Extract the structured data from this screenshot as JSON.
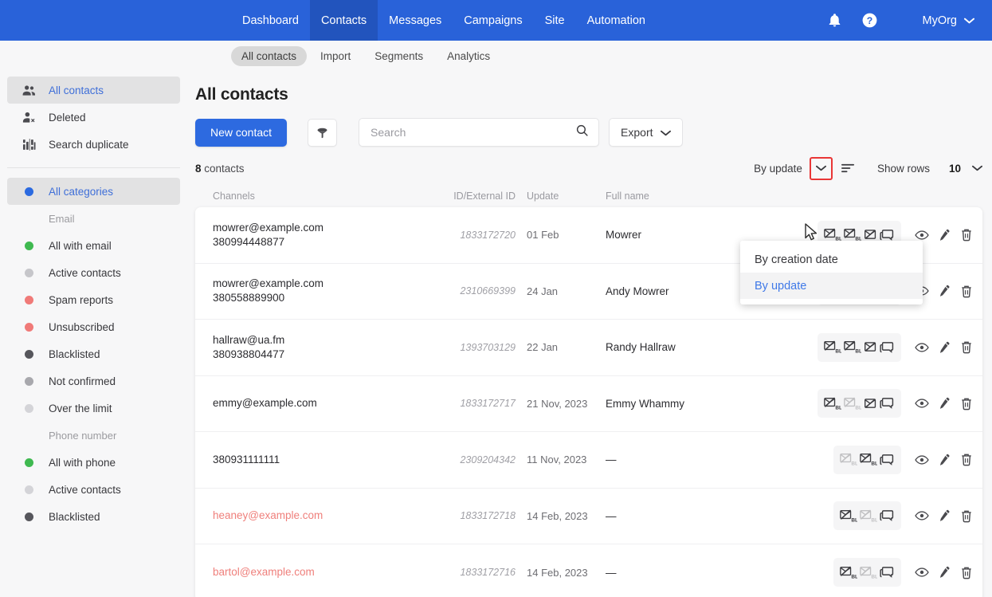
{
  "topnav": {
    "items": [
      {
        "label": "Dashboard",
        "active": false
      },
      {
        "label": "Contacts",
        "active": true
      },
      {
        "label": "Messages",
        "active": false
      },
      {
        "label": "Campaigns",
        "active": false
      },
      {
        "label": "Site",
        "active": false
      },
      {
        "label": "Automation",
        "active": false
      }
    ],
    "bell_icon": "bell-icon",
    "help_icon": "help-circle-icon",
    "org_label": "MyOrg",
    "bg_color": "#2962d9",
    "active_bg_color": "#2254bd"
  },
  "subnav": {
    "items": [
      {
        "label": "All contacts",
        "active": true
      },
      {
        "label": "Import",
        "active": false
      },
      {
        "label": "Segments",
        "active": false
      },
      {
        "label": "Analytics",
        "active": false
      }
    ]
  },
  "sidebar": {
    "top_items": [
      {
        "label": "All contacts",
        "icon": "people-group-icon",
        "active": true
      },
      {
        "label": "Deleted",
        "icon": "person-remove-icon",
        "active": false
      },
      {
        "label": "Search duplicate",
        "icon": "compare-bars-icon",
        "active": false
      }
    ],
    "all_categories": {
      "label": "All categories",
      "dot_color": "#2b6ae0",
      "active": true
    },
    "groups": [
      {
        "label": "Email",
        "items": [
          {
            "label": "All with email",
            "dot_color": "#3fb950"
          },
          {
            "label": "Active contacts",
            "dot_color": "#c6c6ca"
          },
          {
            "label": "Spam reports",
            "dot_color": "#f07a78"
          },
          {
            "label": "Unsubscribed",
            "dot_color": "#f07a78"
          },
          {
            "label": "Blacklisted",
            "dot_color": "#56565c"
          },
          {
            "label": "Not confirmed",
            "dot_color": "#a8a8ad"
          },
          {
            "label": "Over the limit",
            "dot_color": "#d4d4d8"
          }
        ]
      },
      {
        "label": "Phone number",
        "items": [
          {
            "label": "All with phone",
            "dot_color": "#3fb950"
          },
          {
            "label": "Active contacts",
            "dot_color": "#d4d4d8"
          },
          {
            "label": "Blacklisted",
            "dot_color": "#56565c"
          }
        ]
      }
    ]
  },
  "main": {
    "page_title": "All contacts",
    "new_contact_label": "New contact",
    "filter_icon": "filter-funnel-icon",
    "search_placeholder": "Search",
    "search_value": "",
    "search_icon": "search-icon",
    "export_label": "Export",
    "count_number": "8",
    "count_suffix": "contacts",
    "sort_label": "By update",
    "sort_dir_icon": "sort-descending-icon",
    "show_rows_label": "Show rows",
    "rows_value": "10"
  },
  "dropdown": {
    "open": true,
    "items": [
      {
        "label": "By creation date",
        "selected": false
      },
      {
        "label": "By update",
        "selected": true
      }
    ],
    "selected_color": "#3f79e8",
    "highlight_color": "#e93636"
  },
  "table": {
    "headers": {
      "channels": "Channels",
      "id": "ID/External ID",
      "update": "Update",
      "full_name": "Full name"
    },
    "rows": [
      {
        "email": "mowrer@example.com",
        "phone": "380994448877",
        "email_red": false,
        "id": "1833172720",
        "update": "01 Feb",
        "full_name": "Mowrer",
        "channel_icons": [
          {
            "name": "email-blacklist-icon",
            "disabled": false
          },
          {
            "name": "sms-blacklist-icon",
            "disabled": false
          },
          {
            "name": "email-off-icon",
            "disabled": false
          },
          {
            "name": "chat-icon",
            "disabled": false
          }
        ],
        "covered_by_dropdown": true
      },
      {
        "email": "mowrer@example.com",
        "phone": "380558889900",
        "email_red": false,
        "id": "2310669399",
        "update": "24 Jan",
        "full_name": "Andy Mowrer",
        "channel_icons": [
          {
            "name": "email-blacklist-icon",
            "disabled": false
          },
          {
            "name": "sms-blacklist-icon",
            "disabled": false
          },
          {
            "name": "email-off-icon",
            "disabled": false
          },
          {
            "name": "chat-icon",
            "disabled": false
          }
        ],
        "covered_by_dropdown": false
      },
      {
        "email": "hallraw@ua.fm",
        "phone": "380938804477",
        "email_red": false,
        "id": "1393703129",
        "update": "22 Jan",
        "full_name": "Randy Hallraw",
        "channel_icons": [
          {
            "name": "email-blacklist-icon",
            "disabled": false
          },
          {
            "name": "sms-blacklist-icon",
            "disabled": false
          },
          {
            "name": "email-off-icon",
            "disabled": false
          },
          {
            "name": "chat-icon",
            "disabled": false
          }
        ],
        "covered_by_dropdown": false
      },
      {
        "email": "emmy@example.com",
        "phone": "",
        "email_red": false,
        "id": "1833172717",
        "update": "21 Nov, 2023",
        "full_name": "Emmy Whammy",
        "channel_icons": [
          {
            "name": "email-blacklist-icon",
            "disabled": false
          },
          {
            "name": "sms-blacklist-icon",
            "disabled": true
          },
          {
            "name": "email-off-icon",
            "disabled": false
          },
          {
            "name": "chat-icon",
            "disabled": false
          }
        ],
        "covered_by_dropdown": false
      },
      {
        "email": "",
        "phone": "380931111111",
        "email_red": false,
        "id": "2309204342",
        "update": "11 Nov, 2023",
        "full_name": "—",
        "channel_icons": [
          {
            "name": "email-blacklist-icon",
            "disabled": true
          },
          {
            "name": "sms-blacklist-icon",
            "disabled": false
          },
          {
            "name": "chat-icon",
            "disabled": false
          }
        ],
        "covered_by_dropdown": false
      },
      {
        "email": "heaney@example.com",
        "phone": "",
        "email_red": true,
        "id": "1833172718",
        "update": "14 Feb, 2023",
        "full_name": "—",
        "channel_icons": [
          {
            "name": "email-blacklist-icon",
            "disabled": false
          },
          {
            "name": "sms-blacklist-icon",
            "disabled": true
          },
          {
            "name": "chat-icon",
            "disabled": false
          }
        ],
        "covered_by_dropdown": false
      },
      {
        "email": "bartol@example.com",
        "phone": "",
        "email_red": true,
        "id": "1833172716",
        "update": "14 Feb, 2023",
        "full_name": "—",
        "channel_icons": [
          {
            "name": "email-blacklist-icon",
            "disabled": false
          },
          {
            "name": "sms-blacklist-icon",
            "disabled": true
          },
          {
            "name": "chat-icon",
            "disabled": false
          }
        ],
        "covered_by_dropdown": false
      }
    ],
    "action_icons": [
      {
        "name": "eye-icon"
      },
      {
        "name": "pencil-icon"
      },
      {
        "name": "trash-icon"
      }
    ]
  }
}
